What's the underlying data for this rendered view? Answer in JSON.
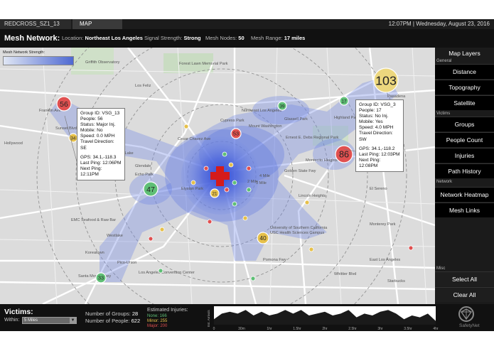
{
  "top": {
    "tab1": "REDCROSS_SZ1_13",
    "tab2": "MAP",
    "clock": "12:07PM  |  Wednesday, August 23, 2016"
  },
  "info": {
    "title": "Mesh Network:",
    "location_label": "Location:",
    "location": "Northeast Los Angeles",
    "signal_label": "Signal Strength:",
    "signal": "Strong",
    "nodes_label": "Mesh Nodes:",
    "nodes": "50",
    "range_label": "Mesh Range:",
    "range": "17 miles"
  },
  "map": {
    "legend_label": "Mesh Network Strength:",
    "labels": [
      "Griffith Observatory",
      "Forest Lawn Memorial Park",
      "Los Feliz",
      "Franklin Ave",
      "Sunset Blvd",
      "Hollywood",
      "Silver Lake",
      "Echo Park",
      "Elysian Park",
      "Northeast Los Angeles",
      "Cypress Park",
      "Glassell Park",
      "Highland Park",
      "Mount Washington",
      "Montecito Heights",
      "Lincoln Heights",
      "El Sereno",
      "Ernest E. Debs Regional Park",
      "Pasadena",
      "Glendale",
      "Monterey Park",
      "East Los Angeles",
      "University of Southern California",
      "USC Health Sciences Campus",
      "EMC Seafood & Raw Bar",
      "Pico-Union",
      "Los Angeles Convention Center",
      "Koreatown",
      "Santa Monica Fwy",
      "Golden State Fwy",
      "Pomona Fwy",
      "Westlake",
      "Starbucks",
      "4 Mile",
      "3 Mile",
      "2 Mile",
      "Cesar Chavez Ave",
      "Whittier Blvd"
    ],
    "groups": [
      {
        "id": "56",
        "color": "#e05050"
      },
      {
        "id": "34",
        "color": "#e6c04a"
      },
      {
        "id": "103",
        "color": "#ecd77e"
      },
      {
        "id": "17",
        "color": "#5fbf76"
      },
      {
        "id": "39",
        "color": "#5fbf76"
      },
      {
        "id": "53",
        "color": "#e05050"
      },
      {
        "id": "86",
        "color": "#e05050"
      },
      {
        "id": "47",
        "color": "#5fbf76"
      },
      {
        "id": "21",
        "color": "#e6c04a"
      },
      {
        "id": "40",
        "color": "#e6c04a"
      },
      {
        "id": "33",
        "color": "#5fbf76"
      }
    ]
  },
  "callouts": [
    {
      "group": "Group ID: VSG_13",
      "people": "People: 56",
      "status": "Status: Major Inj.",
      "mobile": "Mobile: No",
      "speed": "Speed: 0.0 MPH",
      "direction": "Travel Direction: SE",
      "gps": "GPS: 34.1,-118.3",
      "last_ping": "Last Ping: 12:06PM",
      "next_ping": "Next Ping: 12:11PM"
    },
    {
      "group": "Group ID: VSG_3",
      "people": "People: 17",
      "status": "Status: No Inj.",
      "mobile": "Mobile: Yes",
      "speed": "Speed: 4.0 MPH",
      "direction": "Travel Direction: SW",
      "gps": "GPS: 34.1,-118.2",
      "last_ping": "Last Ping: 12:03PM",
      "next_ping": "Next Ping: 12:08PM"
    }
  ],
  "panel": {
    "title": "Map Layers",
    "general": "General",
    "victims": "Victims",
    "network": "Network",
    "misc": "Misc",
    "buttons": {
      "distance": "Distance",
      "topography": "Topography",
      "satellite": "Satellite",
      "groups": "Groups",
      "people_count": "People Count",
      "injuries": "Injuries",
      "path_history": "Path History",
      "network_heatmap": "Network Heatmap",
      "mesh_links": "Mesh Links",
      "select_all": "Select All",
      "clear_all": "Clear All"
    }
  },
  "bottom": {
    "victims_title": "Victims:",
    "within_label": "Within:",
    "within_value": "5 Miles",
    "groups_label": "Number of Groups:",
    "groups_value": "28",
    "people_label": "Number of People:",
    "people_value": "622",
    "injuries_title": "Estimated Injuries:",
    "inj_none": "None: 166",
    "inj_minor": "Minor: 255",
    "inj_major": "Major: 200",
    "colors": {
      "none": "#5fbf76",
      "minor": "#e6c04a",
      "major": "#e05050"
    },
    "logo": "SafetyNet"
  },
  "chart_data": {
    "type": "area",
    "ylabel": "Est. Arrivals",
    "categories": [
      "0",
      "30m",
      "1hr",
      "1.5hr",
      "2hr",
      "2.5hr",
      "3hr",
      "3.5hr",
      "4hr"
    ],
    "values": [
      3,
      6,
      7,
      6,
      8,
      5,
      7,
      5,
      6,
      8,
      6,
      8,
      5,
      6,
      7,
      5,
      6,
      8,
      4,
      6,
      5,
      7,
      8,
      6,
      3,
      5,
      4,
      6,
      2
    ]
  }
}
